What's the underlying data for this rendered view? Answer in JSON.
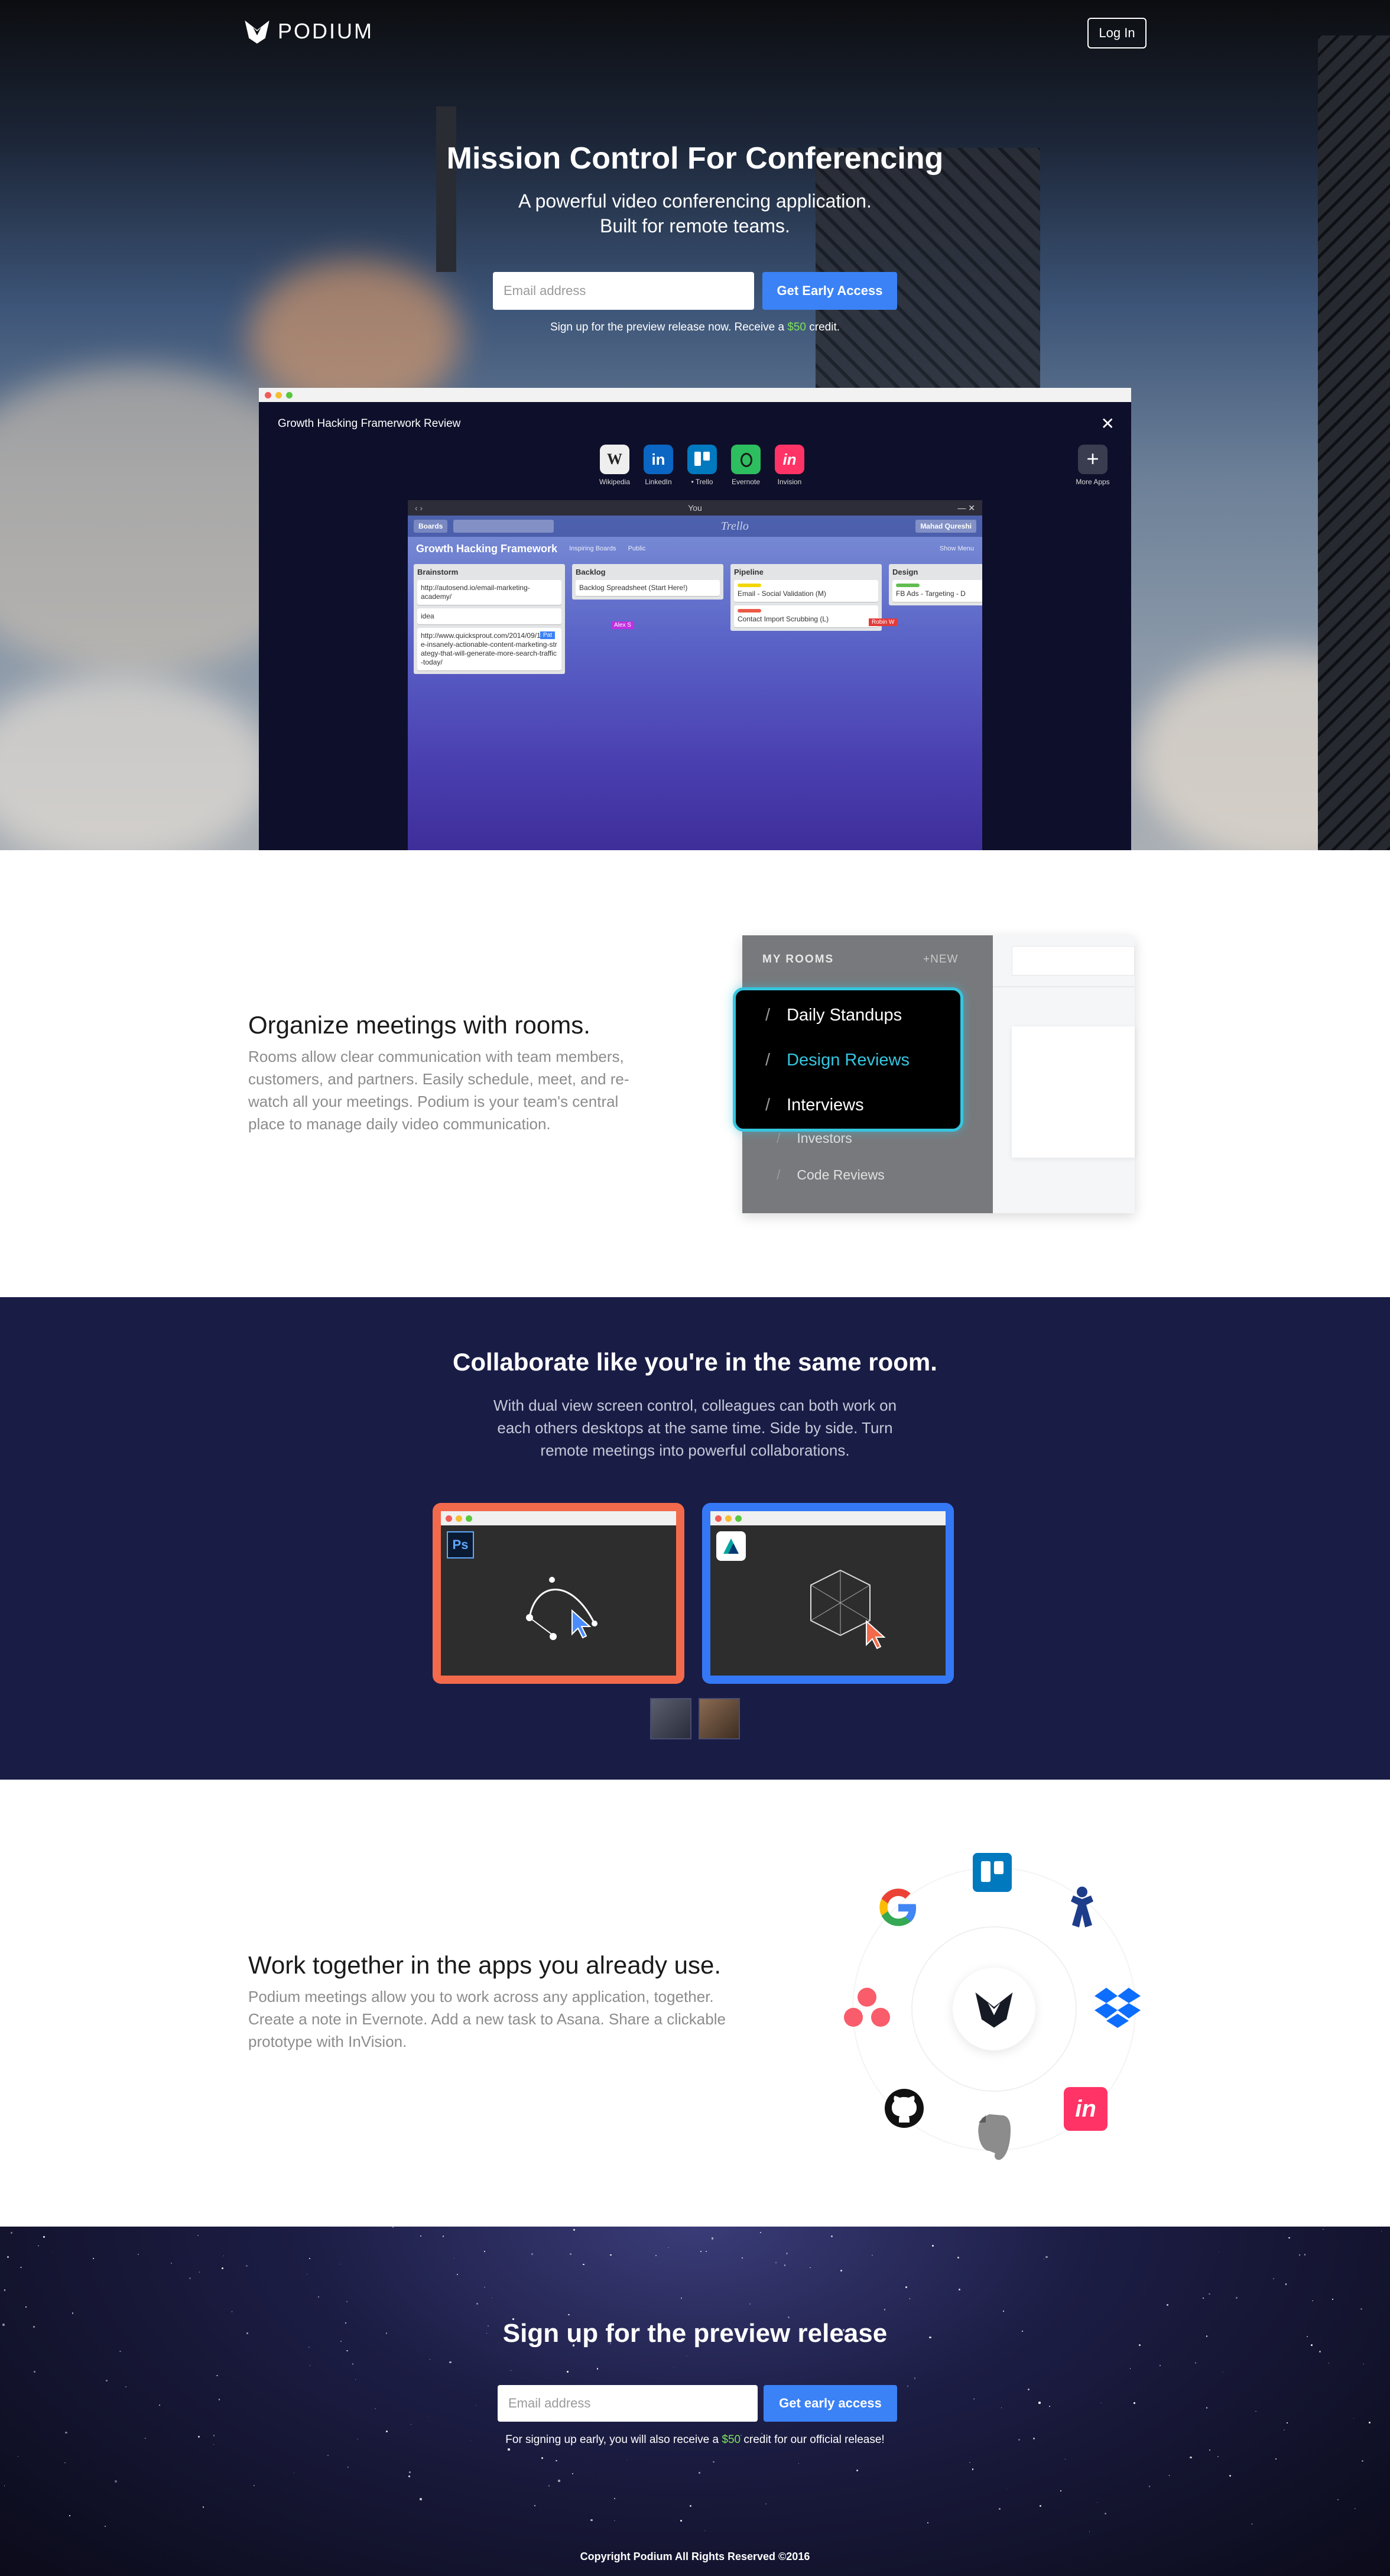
{
  "nav": {
    "logo_text": "PODIUM",
    "login_label": "Log In"
  },
  "hero": {
    "title": "Mission Control For Conferencing",
    "subtitle_line1": "A powerful video conferencing application.",
    "subtitle_line2": "Built for remote teams.",
    "email_placeholder": "Email address",
    "cta_label": "Get Early Access",
    "note_before": "Sign up for the preview release now. Receive a",
    "note_credit": "$50",
    "note_after": "credit."
  },
  "app_window": {
    "title": "Growth Hacking Framerwork Review",
    "close_glyph": "✕",
    "apps": [
      {
        "label": "Wikipedia",
        "glyph": "W",
        "color": "#e8e8e8",
        "icon": "wikipedia-icon"
      },
      {
        "label": "LinkedIn",
        "glyph": "in",
        "color": "#0a66c2",
        "icon": "linkedin-icon"
      },
      {
        "label": "• Trello",
        "glyph": "",
        "color": "#0079bf",
        "icon": "trello-icon"
      },
      {
        "label": "Evernote",
        "glyph": "",
        "color": "#2dbe60",
        "icon": "evernote-icon"
      },
      {
        "label": "Invision",
        "glyph": "in",
        "color": "#ff3366",
        "icon": "invision-icon"
      }
    ],
    "more_label": "More Apps",
    "trello": {
      "window_title": "You",
      "boards_label": "Boards",
      "logo": "Trello",
      "user": "Mahad Qureshi",
      "board_name": "Growth Hacking Framework",
      "board_tag1": "Inspiring Boards",
      "board_tag2": "Public",
      "show_menu": "Show Menu",
      "cursor_alex": "Alex S",
      "cursor_pc": "Pat",
      "cursor_robin": "Robin W",
      "lists": [
        {
          "name": "Brainstorm",
          "cards": [
            "http://autosend.io/email-marketing-academy/",
            "idea",
            "http://www.quicksprout.com/2014/09/15/one-insanely-actionable-content-marketing-strategy-that-will-generate-more-search-traffic-today/"
          ]
        },
        {
          "name": "Backlog",
          "cards": [
            "Backlog Spreadsheet (Start Here!)"
          ]
        },
        {
          "name": "Pipeline",
          "cards": [
            "Email - Social Validation (M)",
            "Contact Import Scrubbing (L)"
          ]
        },
        {
          "name": "Design",
          "cards": [
            "FB Ads - Targeting - D"
          ]
        }
      ]
    }
  },
  "rooms": {
    "title": "Organize meetings with rooms.",
    "body": "Rooms allow clear communication with team members, customers, and partners. Easily schedule, meet, and re-watch all your meetings. Podium is your team's central place to manage daily video communication.",
    "panel_header": "MY ROOMS",
    "panel_new": "+NEW",
    "popup_items": [
      "Daily Standups",
      "Design Reviews",
      "Interviews"
    ],
    "list_items": [
      "Investors",
      "Code Reviews"
    ],
    "active_color": "#36c5e0"
  },
  "collab": {
    "title": "Collaborate like you're in the same room.",
    "body_line1": "With dual view screen control, colleagues can both work on",
    "body_line2": "each others desktops at the same time. Side by side. Turn",
    "body_line3": "remote meetings into powerful collaborations.",
    "left_app": "Ps",
    "left_border": "#f26a4b",
    "right_border": "#3578f6"
  },
  "apps_section": {
    "title": "Work together in the apps you already use.",
    "body": "Podium meetings allow you to work across any application, together. Create a note in Evernote. Add a new task to Asana. Share a clickable prototype with InVision.",
    "orbit_apps": [
      "google-icon",
      "trello-icon",
      "jira-icon",
      "asana-icon",
      "dropbox-icon",
      "github-icon",
      "evernote-icon",
      "invision-icon"
    ]
  },
  "signup": {
    "title": "Sign up for the preview release",
    "email_placeholder": "Email address",
    "cta_label": "Get early access",
    "note_before": "For signing up early, you will also receive a",
    "note_credit": "$50",
    "note_after": "credit for our official release!",
    "footer": "Copyright Podium All Rights Reserved ©2016"
  }
}
